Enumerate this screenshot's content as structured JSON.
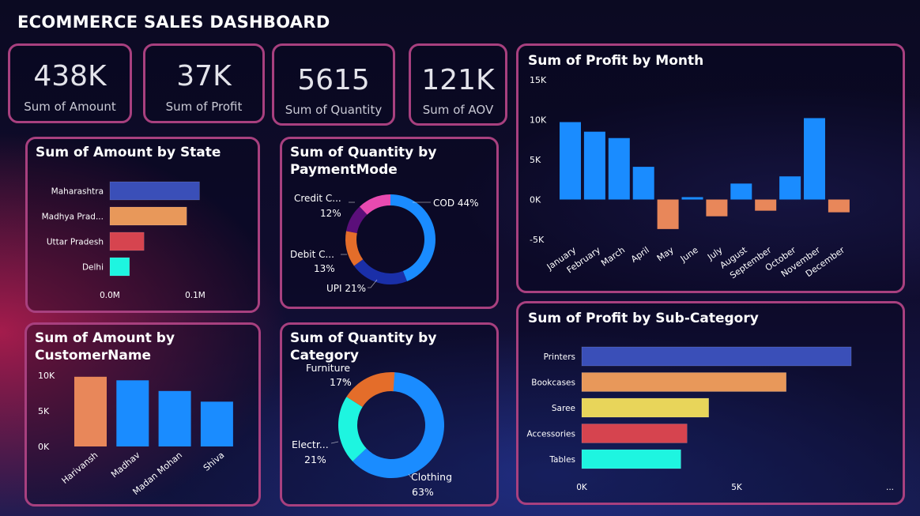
{
  "dashboard": {
    "title": "ECOMMERCE SALES DASHBOARD"
  },
  "kpis": [
    {
      "value": "438K",
      "label": "Sum of Amount"
    },
    {
      "value": "37K",
      "label": "Sum of Profit"
    },
    {
      "value": "5615",
      "label": "Sum of Quantity"
    },
    {
      "value": "121K",
      "label": "Sum of AOV"
    }
  ],
  "chart_data": [
    {
      "id": "amount_by_state",
      "type": "bar",
      "orientation": "horizontal",
      "title": "Sum of Amount by State",
      "categories": [
        "Maharashtra",
        "Madhya Prad...",
        "Uttar Pradesh",
        "Delhi"
      ],
      "values": [
        0.105,
        0.09,
        0.04,
        0.023
      ],
      "colors": [
        "#3a4fb8",
        "#e8985a",
        "#d6444f",
        "#1ef5e0"
      ],
      "xticks": [
        "0.0M",
        "0.1M"
      ],
      "xlim": [
        0,
        0.1
      ]
    },
    {
      "id": "quantity_by_paymentmode",
      "type": "pie",
      "donut": true,
      "title": "Sum of Quantity by PaymentMode",
      "slices": [
        {
          "label": "COD",
          "pct": 44,
          "color": "#1a8cff",
          "display": "COD 44%"
        },
        {
          "label": "UPI",
          "pct": 21,
          "color": "#1a2fa8",
          "display": "UPI 21%"
        },
        {
          "label": "Debit C...",
          "pct": 13,
          "color": "#e46d2a",
          "display": "13%"
        },
        {
          "label": "",
          "pct": 10,
          "color": "#5b0f7a",
          "display": ""
        },
        {
          "label": "Credit C...",
          "pct": 12,
          "color": "#e84ab0",
          "display": "12%"
        }
      ]
    },
    {
      "id": "profit_by_month",
      "type": "bar",
      "title": "Sum of Profit by Month",
      "categories": [
        "January",
        "February",
        "March",
        "April",
        "May",
        "June",
        "July",
        "August",
        "September",
        "October",
        "November",
        "December"
      ],
      "values": [
        9700,
        8500,
        7700,
        4100,
        -3700,
        300,
        -2100,
        2000,
        -1400,
        2900,
        10200,
        -1600
      ],
      "ylim": [
        -5000,
        15000
      ],
      "yticks": [
        "15K",
        "10K",
        "5K",
        "0K",
        "-5K"
      ],
      "pos_color": "#1a8cff",
      "neg_color": "#e8875a"
    },
    {
      "id": "amount_by_customer",
      "type": "bar",
      "title": "Sum of Amount by CustomerName",
      "categories": [
        "Harivansh",
        "Madhav",
        "Madan Mohan",
        "Shiva"
      ],
      "values": [
        9800,
        9300,
        7800,
        6300
      ],
      "colors": [
        "#e8875a",
        "#1a8cff",
        "#1a8cff",
        "#1a8cff"
      ],
      "ylim": [
        0,
        10000
      ],
      "yticks": [
        "10K",
        "5K",
        "0K"
      ]
    },
    {
      "id": "quantity_by_category",
      "type": "pie",
      "donut": true,
      "title": "Sum of Quantity by Category",
      "slices": [
        {
          "label": "Clothing",
          "pct": 63,
          "color": "#1a8cff",
          "display": "Clothing"
        },
        {
          "label": "Electr...",
          "pct": 21,
          "color": "#1ef5e0",
          "display": "Electr..."
        },
        {
          "label": "Furniture",
          "pct": 17,
          "color": "#e46d2a",
          "display": "Furniture"
        }
      ],
      "pct_labels": [
        "63%",
        "21%",
        "17%"
      ]
    },
    {
      "id": "profit_by_subcategory",
      "type": "bar",
      "orientation": "horizontal",
      "title": "Sum of Profit by Sub-Category",
      "categories": [
        "Printers",
        "Bookcases",
        "Saree",
        "Accessories",
        "Tables"
      ],
      "values": [
        8700,
        6600,
        4100,
        3400,
        3200
      ],
      "colors": [
        "#3a4fb8",
        "#e8985a",
        "#e8d55a",
        "#d6444f",
        "#1ef5e0"
      ],
      "xticks": [
        "0K",
        "5K",
        "..."
      ],
      "xlim": [
        0,
        5000
      ]
    }
  ]
}
